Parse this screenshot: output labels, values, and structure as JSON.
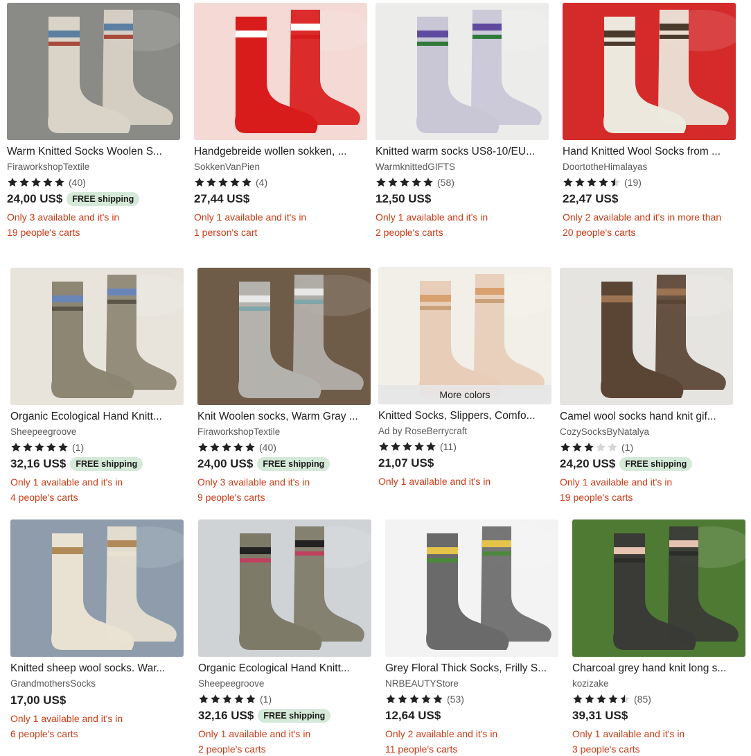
{
  "listings": [
    {
      "title": "Warm Knitted Socks Woolen S...",
      "shop": "FiraworkshopTextile",
      "rating": 5,
      "count": "(40)",
      "price": "24,00 US$",
      "free_shipping": "FREE shipping",
      "stock1": "Only 3 available and it's in",
      "stock2": "19 people's carts"
    },
    {
      "title": "Handgebreide wollen sokken, ...",
      "shop": "SokkenVanPien",
      "rating": 5,
      "count": "(4)",
      "price": "27,44 US$",
      "free_shipping": "",
      "stock1": "Only 1 available and it's in",
      "stock2": "1 person's cart"
    },
    {
      "title": "Knitted warm socks US8-10/EU...",
      "shop": "WarmknittedGIFTS",
      "rating": 5,
      "count": "(58)",
      "price": "12,50 US$",
      "free_shipping": "",
      "stock1": "Only 1 available and it's in",
      "stock2": "2 people's carts"
    },
    {
      "title": "Hand Knitted Wool Socks from ...",
      "shop": "DoortotheHimalayas",
      "rating": 4.5,
      "count": "(19)",
      "price": "22,47 US$",
      "free_shipping": "",
      "stock1": "Only 2 available and it's in more than",
      "stock2": "20 people's carts"
    },
    {
      "title": "Organic Ecological Hand Knitt...",
      "shop": "Sheepeegroove",
      "rating": 5,
      "count": "(1)",
      "price": "32,16 US$",
      "free_shipping": "FREE shipping",
      "stock1": "Only 1 available and it's in",
      "stock2": "4 people's carts"
    },
    {
      "title": "Knit Woolen socks, Warm Gray ...",
      "shop": "FiraworkshopTextile",
      "rating": 5,
      "count": "(40)",
      "price": "24,00 US$",
      "free_shipping": "FREE shipping",
      "stock1": "Only 3 available and it's in",
      "stock2": "9 people's carts"
    },
    {
      "title": "Knitted Socks, Slippers, Comfo...",
      "shop": "Ad by RoseBerrycraft",
      "rating": 5,
      "count": "(11)",
      "price": "21,07 US$",
      "free_shipping": "",
      "stock1": "Only 1 available and it's in",
      "stock2": "",
      "more_colors": "More colors"
    },
    {
      "title": "Camel wool socks hand knit gif...",
      "shop": "CozySocksByNatalya",
      "rating": 3,
      "count": "(1)",
      "price": "24,20 US$",
      "free_shipping": "FREE shipping",
      "stock1": "Only 1 available and it's in",
      "stock2": "19 people's carts"
    },
    {
      "title": "Knitted sheep wool socks. War...",
      "shop": "GrandmothersSocks",
      "rating": 0,
      "count": "",
      "price": "17,00 US$",
      "free_shipping": "",
      "stock1": "Only 1 available and it's in",
      "stock2": "6 people's carts"
    },
    {
      "title": "Organic Ecological Hand Knitt...",
      "shop": "Sheepeegroove",
      "rating": 5,
      "count": "(1)",
      "price": "32,16 US$",
      "free_shipping": "FREE shipping",
      "stock1": "Only 1 available and it's in",
      "stock2": "2 people's carts"
    },
    {
      "title": "Grey Floral Thick Socks, Frilly S...",
      "shop": "NRBEAUTYStore",
      "rating": 5,
      "count": "(53)",
      "price": "12,64 US$",
      "free_shipping": "",
      "stock1": "Only 2 available and it's in",
      "stock2": "11 people's carts"
    },
    {
      "title": "Charcoal grey hand knit long s...",
      "shop": "kozizake",
      "rating": 4.5,
      "count": "(85)",
      "price": "39,31 US$",
      "free_shipping": "",
      "stock1": "Only 1 available and it's in",
      "stock2": "3 people's carts"
    }
  ],
  "colors": {
    "star": "#222222",
    "star_empty": "#d6d6d6",
    "stock": "#cc3b16",
    "badge_bg": "#d4e9d7"
  }
}
